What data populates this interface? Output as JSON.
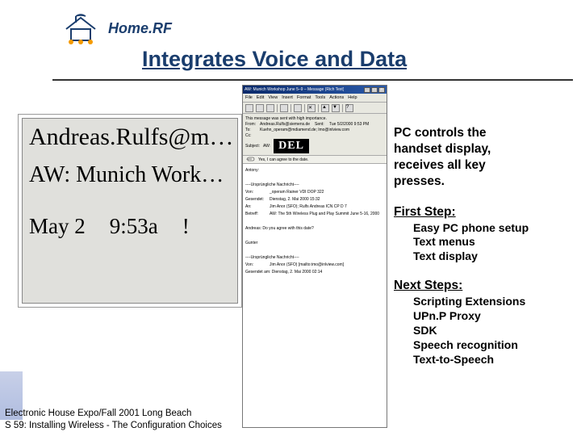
{
  "logo": {
    "brand_a": "Home",
    "brand_b": ".RF"
  },
  "title": "Integrates Voice and Data",
  "handset": {
    "line1": "Andreas.Rulfs@m…",
    "line2": "AW: Munich Work…",
    "line3_date": "May 2",
    "line3_time": "9:53a",
    "line3_mark": "!"
  },
  "email_window": {
    "title": "AW: Munich Workshop June 5–9 – Message (Rich Text)",
    "menus": [
      "File",
      "Edit",
      "View",
      "Insert",
      "Format",
      "Tools",
      "Actions",
      "Help"
    ],
    "toolbar_icons": [
      "reply",
      "reply-all",
      "forward",
      "print",
      "move",
      "delete",
      "prev",
      "next",
      "help"
    ],
    "header_note": "This message was sent with high importance.",
    "from_label": "From:",
    "from_value": "Andreas.Rulfs@siemens.de",
    "sent_label": "Sent:",
    "sent_value": "Tue 5/2/2000 9:53 PM",
    "to_label": "To:",
    "to_value": "Kuehn_operam@mdiamend.de; lmo@inlview.com",
    "cc_label": "Cc:",
    "subject_label": "Subject:",
    "subject_prefix": "AW:",
    "del_badge": "DEL",
    "attach_text": "Yes, I can agree to the date.",
    "body": {
      "greeting": "Antony:",
      "sep1": "----Ursprüngliche Nachricht----",
      "r1l": "Von:",
      "r1v": "_operam Rainer VDI DOP 322",
      "r2l": "Gesendet:",
      "r2v": "Dienstag, 2. Mai 2000 15:32",
      "r3l": "An:",
      "r3v": "Jim Anor (SFO); Rulfs Andreas ICN CP D 7",
      "r4l": "Betreff:",
      "r4v": "AW: The 5th Wireless Plug and Play Summit June  5-16, 2000",
      "q1": "Andreas: Do you agree with this date?",
      "q2": "Gunter",
      "sep2": "----Ursprüngliche Nachricht----",
      "r5l": "Von:",
      "r5v": "Jim Anor (SFO) [mailto:imo@inlview.com]",
      "r6l": "",
      "r6v": "Gesendet am: Dienstag, 2. Mai 2000 02:14"
    }
  },
  "sidebar": {
    "intro": [
      "PC controls the",
      "handset display,",
      "receives all key",
      "presses."
    ],
    "first_title": "First Step:",
    "first_items": [
      "Easy PC phone setup",
      "Text menus",
      "Text display"
    ],
    "next_title": "Next Steps:",
    "next_items": [
      "Scripting Extensions",
      "UPn.P Proxy",
      "SDK",
      "Speech recognition",
      "Text-to-Speech"
    ]
  },
  "footer": {
    "line1": "Electronic House Expo/Fall 2001  Long Beach",
    "line2": "S 59: Installing Wireless - The Configuration Choices"
  }
}
